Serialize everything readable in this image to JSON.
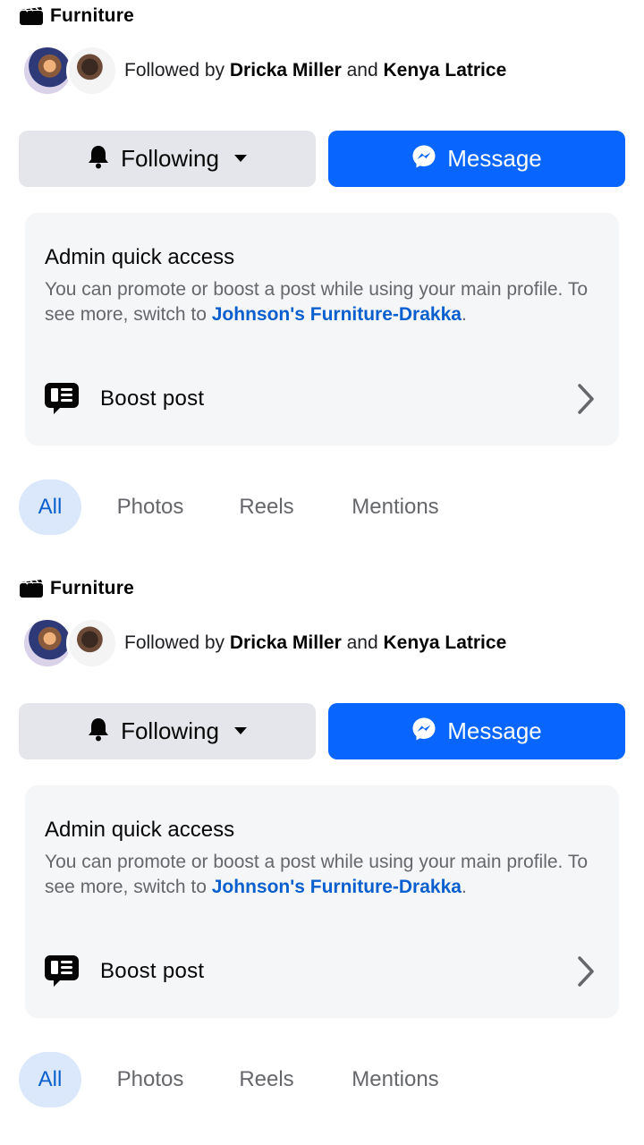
{
  "sections": [
    {
      "category": "Furniture",
      "followed": {
        "prefix": "Followed by ",
        "person1": "Dricka Miller",
        "connector": " and ",
        "person2": "Kenya Latrice"
      },
      "buttons": {
        "following": "Following",
        "message": "Message"
      },
      "admin": {
        "title": "Admin quick access",
        "description": "You can promote or boost a post while using your main profile. To see more, switch to ",
        "link": "Johnson's Furniture-Drakka",
        "period": ".",
        "boost": "Boost post"
      },
      "tabs": [
        "All",
        "Photos",
        "Reels",
        "Mentions"
      ]
    },
    {
      "category": "Furniture",
      "followed": {
        "prefix": "Followed by ",
        "person1": "Dricka Miller",
        "connector": " and ",
        "person2": "Kenya Latrice"
      },
      "buttons": {
        "following": "Following",
        "message": "Message"
      },
      "admin": {
        "title": "Admin quick access",
        "description": "You can promote or boost a post while using your main profile. To see more, switch to ",
        "link": "Johnson's Furniture-Drakka",
        "period": ".",
        "boost": "Boost post"
      },
      "tabs": [
        "All",
        "Photos",
        "Reels",
        "Mentions"
      ]
    }
  ],
  "icons": {
    "category": "clapperboard-icon",
    "bell": "bell-icon",
    "caret": "caret-down-icon",
    "messenger": "messenger-icon",
    "boost": "boost-post-icon",
    "chevron": "chevron-right-icon"
  },
  "colors": {
    "accent": "#0866ff",
    "link": "#0a5fcf",
    "secondary_button": "#e4e6eb",
    "card_background": "#f5f6f8",
    "active_tab_background": "#dbe8fb"
  }
}
